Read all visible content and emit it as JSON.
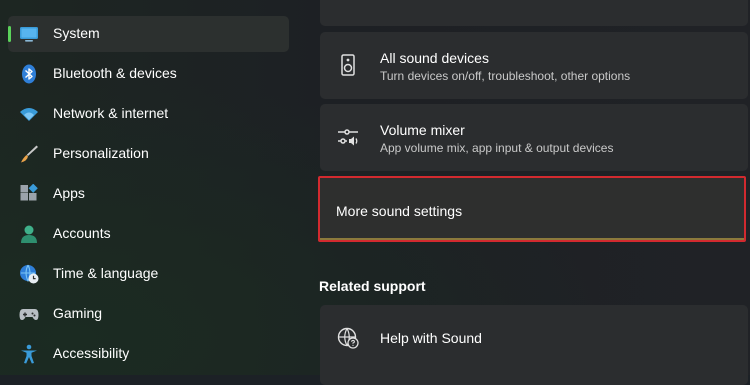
{
  "sidebar": {
    "items": [
      {
        "label": "System",
        "icon": "laptop-icon",
        "selected": true
      },
      {
        "label": "Bluetooth & devices",
        "icon": "bluetooth-icon"
      },
      {
        "label": "Network & internet",
        "icon": "wifi-icon"
      },
      {
        "label": "Personalization",
        "icon": "paintbrush-icon"
      },
      {
        "label": "Apps",
        "icon": "apps-icon"
      },
      {
        "label": "Accounts",
        "icon": "person-icon"
      },
      {
        "label": "Time & language",
        "icon": "globe-clock-icon"
      },
      {
        "label": "Gaming",
        "icon": "gamepad-icon"
      },
      {
        "label": "Accessibility",
        "icon": "accessibility-icon"
      }
    ],
    "accent_color": "#5bd35b"
  },
  "main": {
    "all_sound_devices": {
      "title": "All sound devices",
      "subtitle": "Turn devices on/off, troubleshoot, other options",
      "icon": "speaker-icon"
    },
    "volume_mixer": {
      "title": "Volume mixer",
      "subtitle": "App volume mix, app input & output devices",
      "icon": "mixer-sliders-icon"
    },
    "more_sound_settings": {
      "title": "More sound settings",
      "highlight_color": "#d22a2f"
    },
    "related_support": {
      "heading": "Related support",
      "help_with_sound": {
        "title": "Help with Sound",
        "icon": "globe-help-icon"
      }
    }
  }
}
